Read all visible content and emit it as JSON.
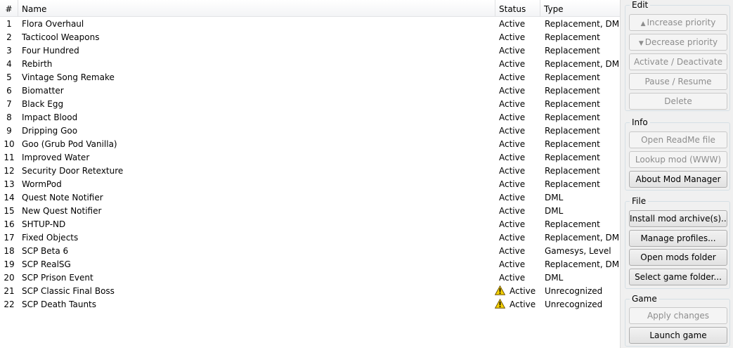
{
  "list": {
    "columns": {
      "num": "#",
      "name": "Name",
      "status": "Status",
      "type": "Type"
    },
    "rows": [
      {
        "num": "1",
        "name": "Flora Overhaul",
        "status": "Active",
        "type": "Replacement, DML",
        "warning": false
      },
      {
        "num": "2",
        "name": "Tacticool Weapons",
        "status": "Active",
        "type": "Replacement",
        "warning": false
      },
      {
        "num": "3",
        "name": "Four Hundred",
        "status": "Active",
        "type": "Replacement",
        "warning": false
      },
      {
        "num": "4",
        "name": "Rebirth",
        "status": "Active",
        "type": "Replacement, DML",
        "warning": false
      },
      {
        "num": "5",
        "name": "Vintage Song Remake",
        "status": "Active",
        "type": "Replacement",
        "warning": false
      },
      {
        "num": "6",
        "name": "Biomatter",
        "status": "Active",
        "type": "Replacement",
        "warning": false
      },
      {
        "num": "7",
        "name": "Black Egg",
        "status": "Active",
        "type": "Replacement",
        "warning": false
      },
      {
        "num": "8",
        "name": "Impact Blood",
        "status": "Active",
        "type": "Replacement",
        "warning": false
      },
      {
        "num": "9",
        "name": "Dripping Goo",
        "status": "Active",
        "type": "Replacement",
        "warning": false
      },
      {
        "num": "10",
        "name": "Goo (Grub Pod Vanilla)",
        "status": "Active",
        "type": "Replacement",
        "warning": false
      },
      {
        "num": "11",
        "name": "Improved Water",
        "status": "Active",
        "type": "Replacement",
        "warning": false
      },
      {
        "num": "12",
        "name": "Security Door Retexture",
        "status": "Active",
        "type": "Replacement",
        "warning": false
      },
      {
        "num": "13",
        "name": "WormPod",
        "status": "Active",
        "type": "Replacement",
        "warning": false
      },
      {
        "num": "14",
        "name": "Quest Note Notifier",
        "status": "Active",
        "type": "DML",
        "warning": false
      },
      {
        "num": "15",
        "name": "New Quest Notifier",
        "status": "Active",
        "type": "DML",
        "warning": false
      },
      {
        "num": "16",
        "name": "SHTUP-ND",
        "status": "Active",
        "type": "Replacement",
        "warning": false
      },
      {
        "num": "17",
        "name": "Fixed Objects",
        "status": "Active",
        "type": "Replacement, DML",
        "warning": false
      },
      {
        "num": "18",
        "name": "SCP Beta 6",
        "status": "Active",
        "type": "Gamesys, Level",
        "warning": false
      },
      {
        "num": "19",
        "name": "SCP RealSG",
        "status": "Active",
        "type": "Replacement, DML",
        "warning": false
      },
      {
        "num": "20",
        "name": "SCP Prison Event",
        "status": "Active",
        "type": "DML",
        "warning": false
      },
      {
        "num": "21",
        "name": "SCP Classic Final Boss",
        "status": "Active",
        "type": "Unrecognized",
        "warning": true
      },
      {
        "num": "22",
        "name": "SCP Death Taunts",
        "status": "Active",
        "type": "Unrecognized",
        "warning": true
      }
    ]
  },
  "side": {
    "edit": {
      "title": "Edit",
      "increase_priority": "Increase priority",
      "decrease_priority": "Decrease priority",
      "activate_deactivate": "Activate / Deactivate",
      "pause_resume": "Pause / Resume",
      "delete": "Delete"
    },
    "info": {
      "title": "Info",
      "open_readme": "Open ReadMe file",
      "lookup_mod": "Lookup mod (WWW)",
      "about": "About Mod Manager"
    },
    "file": {
      "title": "File",
      "install_archive": "Install mod archive(s)...",
      "manage_profiles": "Manage profiles...",
      "open_mods_folder": "Open mods folder",
      "select_game_folder": "Select game folder..."
    },
    "game": {
      "title": "Game",
      "apply_changes": "Apply changes",
      "launch_game": "Launch game"
    }
  },
  "icons": {
    "up": "triangle-up-icon",
    "down": "triangle-down-icon",
    "warning": "warning-icon"
  },
  "colors": {
    "warning_fill": "#f5d000",
    "selection": "#e8f1fb"
  }
}
